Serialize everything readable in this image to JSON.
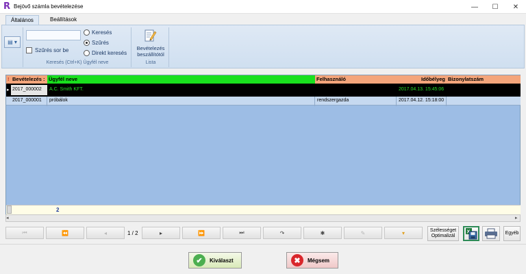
{
  "window": {
    "title": "Bejövő számla bevételezése",
    "minimize": "—",
    "maximize": "☐",
    "close": "✕"
  },
  "ribbon": {
    "tabs": [
      "Általános",
      "Beállítások"
    ],
    "filter_label": "Szűrés sor be",
    "radios": [
      "Keresés",
      "Szűrés",
      "Direkt keresés"
    ],
    "selected_radio": 1,
    "search_group_label": "Keresés (Ctrl+K) Ügyfél neve",
    "big_button_label_1": "Bevételezés",
    "big_button_label_2": "beszállítótól",
    "list_group_label": "Lista"
  },
  "grid": {
    "columns": [
      "Bevételezés :",
      "Ügyfél neve",
      "Felhasználó",
      "Időbélyeg",
      "Bizonylatszám"
    ],
    "rows": [
      {
        "id": "2017_000002",
        "customer": "A.C. Smith KFT.",
        "user": "",
        "timestamp": "2017.04.13. 15:45:06",
        "doc": "",
        "selected": true
      },
      {
        "id": "2017_000001",
        "customer": "próbálok",
        "user": "rendszergazda",
        "timestamp": "2017.04.12. 15:18:00",
        "doc": "",
        "selected": false
      }
    ],
    "summary_count": "2"
  },
  "navigator": {
    "page": "1 / 2",
    "buttons": [
      "⏮",
      "⏪",
      "◂",
      "▸",
      "⏩",
      "⏭",
      "↷",
      "✱",
      "✎",
      "▾"
    ],
    "optimize_label_1": "Szélességet",
    "optimize_label_2": "Optimalizál",
    "other_label": "Egyéb"
  },
  "actions": {
    "select": "Kiválaszt",
    "cancel": "Mégsem"
  },
  "colors": {
    "header_bg": "#f4a57b",
    "customer_header_bg": "#19e01e",
    "grid_bg": "#9dbde5",
    "selected_row_bg": "#000000",
    "selected_text": "#27e02a"
  }
}
